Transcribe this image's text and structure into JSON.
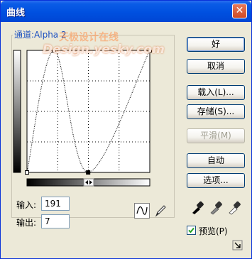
{
  "window": {
    "title": "曲线",
    "close_glyph": "✕"
  },
  "channel": {
    "label": "通道:Alpha 2"
  },
  "curve": {
    "points": [
      [
        0,
        0
      ],
      [
        56,
        255
      ],
      [
        127,
        0
      ],
      [
        255,
        255
      ]
    ],
    "selected_point": [
      127,
      0
    ]
  },
  "buttons": {
    "ok": "好",
    "cancel": "取消",
    "load": "载入(L)...",
    "save": "存储(S)...",
    "smooth": "平滑(M)",
    "auto": "自动",
    "options": "选项..."
  },
  "input": {
    "label": "输入:",
    "value": "191"
  },
  "output": {
    "label": "输出:",
    "value": "7"
  },
  "preview": {
    "label": "预览(P)",
    "checked": true
  },
  "watermark": {
    "cn": "天极设计在线",
    "en": "Design.yesky.com"
  },
  "icons": {
    "curve_tool": "curve-tool-icon",
    "pencil_tool": "pencil-tool-icon",
    "black_eyedropper": "eyedropper-black-icon",
    "gray_eyedropper": "eyedropper-gray-icon",
    "white_eyedropper": "eyedropper-white-icon",
    "expand": "expand-icon"
  }
}
